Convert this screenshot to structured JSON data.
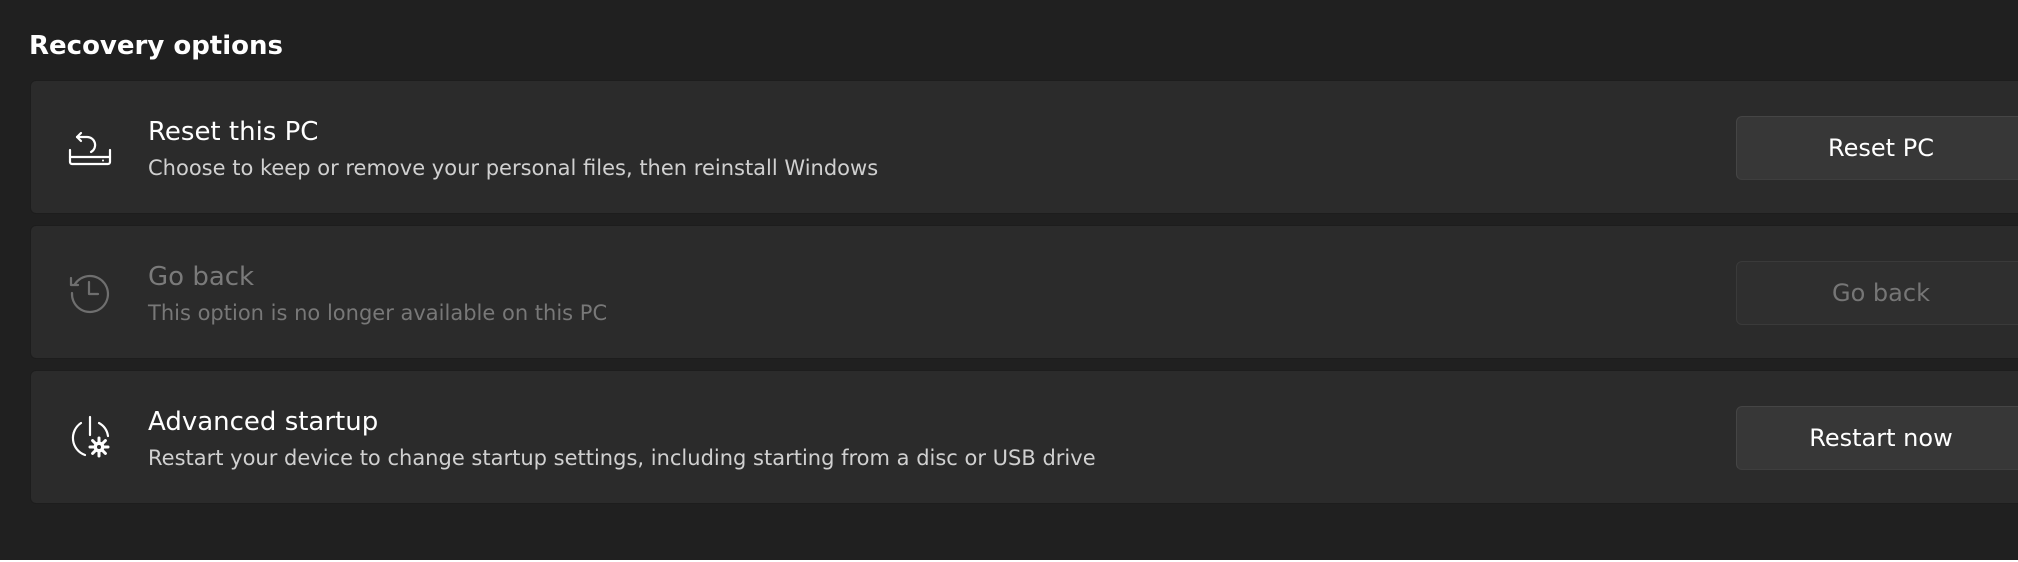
{
  "section": {
    "title": "Recovery options"
  },
  "options": [
    {
      "icon": "reset-pc-icon",
      "title": "Reset this PC",
      "description": "Choose to keep or remove your personal files, then reinstall Windows",
      "button_label": "Reset PC",
      "enabled": true
    },
    {
      "icon": "history-icon",
      "title": "Go back",
      "description": "This option is no longer available on this PC",
      "button_label": "Go back",
      "enabled": false
    },
    {
      "icon": "advanced-startup-icon",
      "title": "Advanced startup",
      "description": "Restart your device to change startup settings, including starting from a disc or USB drive",
      "button_label": "Restart now",
      "enabled": true
    }
  ],
  "colors": {
    "background": "#202020",
    "card": "#2b2b2b",
    "button": "#373737",
    "text": "#ffffff",
    "text_secondary": "#d0d0d0",
    "text_disabled": "#7a7a7a"
  }
}
